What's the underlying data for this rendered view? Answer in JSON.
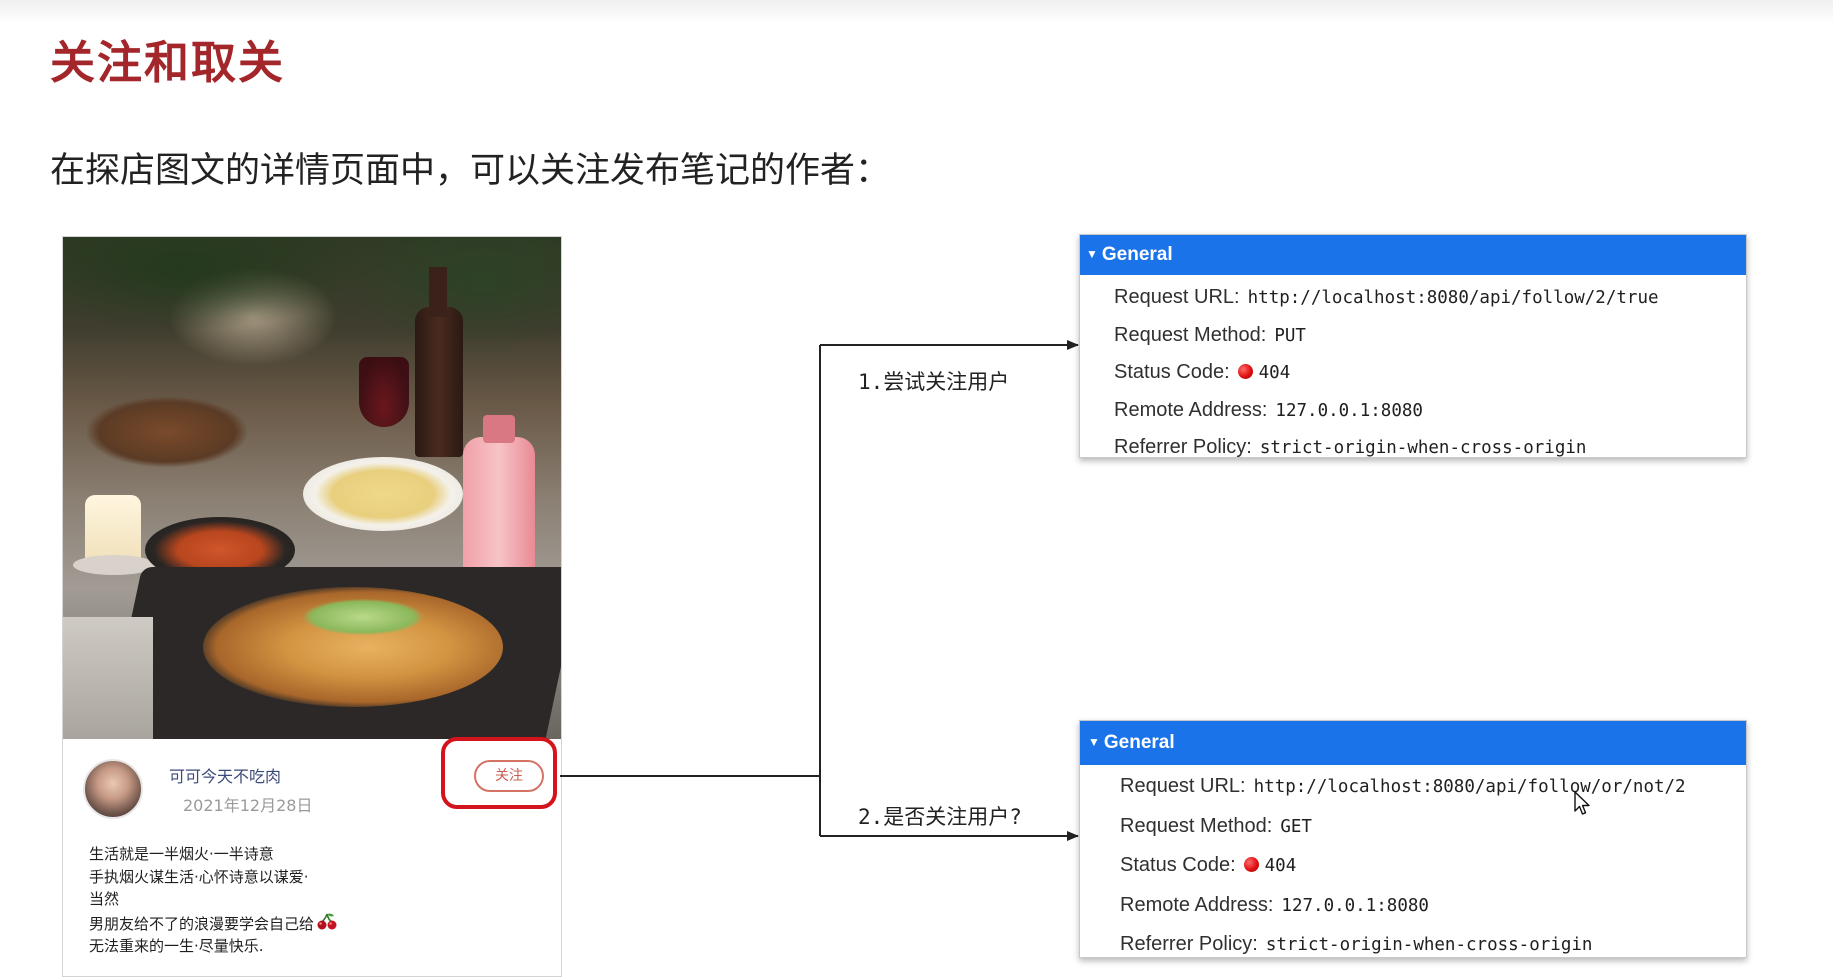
{
  "slide": {
    "title": "关注和取关",
    "subtitle": "在探店图文的详情页面中，可以关注发布笔记的作者："
  },
  "post_card": {
    "author_name": "可可今天不吃肉",
    "date": "2021年12月28日",
    "follow_label": "关注",
    "text_lines": [
      "生活就是一半烟火·一半诗意",
      "手执烟火谋生活·心怀诗意以谋爱·",
      "当然",
      "男朋友给不了的浪漫要学会自己给",
      "无法重来的一生·尽量快乐."
    ]
  },
  "steps": {
    "step1": "1.尝试关注用户",
    "step2": "2.是否关注用户?"
  },
  "panels": {
    "top": {
      "header": "General",
      "request_url_label": "Request URL:",
      "request_url": "http://localhost:8080/api/follow/2/true",
      "method_label": "Request Method:",
      "method": "PUT",
      "status_label": "Status Code:",
      "status": "404",
      "remote_label": "Remote Address:",
      "remote": "127.0.0.1:8080",
      "referrer_label": "Referrer Policy:",
      "referrer": "strict-origin-when-cross-origin"
    },
    "bottom": {
      "header": "General",
      "request_url_label": "Request URL:",
      "request_url": "http://localhost:8080/api/follow/or/not/2",
      "method_label": "Request Method:",
      "method": "GET",
      "status_label": "Status Code:",
      "status": "404",
      "remote_label": "Remote Address:",
      "remote": "127.0.0.1:8080",
      "referrer_label": "Referrer Policy:",
      "referrer": "strict-origin-when-cross-origin"
    }
  },
  "colors": {
    "title": "#a3262b",
    "highlight": "#d3141c",
    "panel_header": "#1a73e8",
    "status_dot": "#e01010"
  }
}
